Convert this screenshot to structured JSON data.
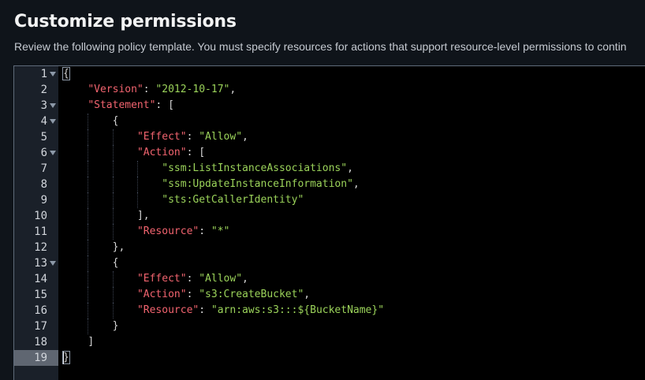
{
  "header": {
    "title": "Customize permissions",
    "description": "Review the following policy template. You must specify resources for actions that support resource-level permissions to contin"
  },
  "editor": {
    "active_line": 19,
    "lines": [
      {
        "n": "1",
        "fold": true,
        "indent": 0,
        "tokens": [
          {
            "t": "bracket",
            "v": "{",
            "boxed": true
          }
        ]
      },
      {
        "n": "2",
        "fold": false,
        "indent": 1,
        "tokens": [
          {
            "t": "key",
            "v": "\"Version\""
          },
          {
            "t": "punc",
            "v": ": "
          },
          {
            "t": "str",
            "v": "\"2012-10-17\""
          },
          {
            "t": "punc",
            "v": ","
          }
        ]
      },
      {
        "n": "3",
        "fold": true,
        "indent": 1,
        "tokens": [
          {
            "t": "key",
            "v": "\"Statement\""
          },
          {
            "t": "punc",
            "v": ": "
          },
          {
            "t": "bracket",
            "v": "["
          }
        ]
      },
      {
        "n": "4",
        "fold": true,
        "indent": 2,
        "tokens": [
          {
            "t": "bracket",
            "v": "{"
          }
        ]
      },
      {
        "n": "5",
        "fold": false,
        "indent": 3,
        "tokens": [
          {
            "t": "key",
            "v": "\"Effect\""
          },
          {
            "t": "punc",
            "v": ": "
          },
          {
            "t": "str",
            "v": "\"Allow\""
          },
          {
            "t": "punc",
            "v": ","
          }
        ]
      },
      {
        "n": "6",
        "fold": true,
        "indent": 3,
        "tokens": [
          {
            "t": "key",
            "v": "\"Action\""
          },
          {
            "t": "punc",
            "v": ": "
          },
          {
            "t": "bracket",
            "v": "["
          }
        ]
      },
      {
        "n": "7",
        "fold": false,
        "indent": 4,
        "tokens": [
          {
            "t": "str",
            "v": "\"ssm:ListInstanceAssociations\""
          },
          {
            "t": "punc",
            "v": ","
          }
        ]
      },
      {
        "n": "8",
        "fold": false,
        "indent": 4,
        "tokens": [
          {
            "t": "str",
            "v": "\"ssm:UpdateInstanceInformation\""
          },
          {
            "t": "punc",
            "v": ","
          }
        ]
      },
      {
        "n": "9",
        "fold": false,
        "indent": 4,
        "tokens": [
          {
            "t": "str",
            "v": "\"sts:GetCallerIdentity\""
          }
        ]
      },
      {
        "n": "10",
        "fold": false,
        "indent": 3,
        "tokens": [
          {
            "t": "bracket",
            "v": "]"
          },
          {
            "t": "punc",
            "v": ","
          }
        ]
      },
      {
        "n": "11",
        "fold": false,
        "indent": 3,
        "tokens": [
          {
            "t": "key",
            "v": "\"Resource\""
          },
          {
            "t": "punc",
            "v": ": "
          },
          {
            "t": "str",
            "v": "\"*\""
          }
        ]
      },
      {
        "n": "12",
        "fold": false,
        "indent": 2,
        "tokens": [
          {
            "t": "bracket",
            "v": "}"
          },
          {
            "t": "punc",
            "v": ","
          }
        ]
      },
      {
        "n": "13",
        "fold": true,
        "indent": 2,
        "tokens": [
          {
            "t": "bracket",
            "v": "{"
          }
        ]
      },
      {
        "n": "14",
        "fold": false,
        "indent": 3,
        "tokens": [
          {
            "t": "key",
            "v": "\"Effect\""
          },
          {
            "t": "punc",
            "v": ": "
          },
          {
            "t": "str",
            "v": "\"Allow\""
          },
          {
            "t": "punc",
            "v": ","
          }
        ]
      },
      {
        "n": "15",
        "fold": false,
        "indent": 3,
        "tokens": [
          {
            "t": "key",
            "v": "\"Action\""
          },
          {
            "t": "punc",
            "v": ": "
          },
          {
            "t": "str",
            "v": "\"s3:CreateBucket\""
          },
          {
            "t": "punc",
            "v": ","
          }
        ]
      },
      {
        "n": "16",
        "fold": false,
        "indent": 3,
        "tokens": [
          {
            "t": "key",
            "v": "\"Resource\""
          },
          {
            "t": "punc",
            "v": ": "
          },
          {
            "t": "str",
            "v": "\"arn:aws:s3:::${BucketName}\""
          }
        ]
      },
      {
        "n": "17",
        "fold": false,
        "indent": 2,
        "tokens": [
          {
            "t": "bracket",
            "v": "}"
          }
        ]
      },
      {
        "n": "18",
        "fold": false,
        "indent": 1,
        "tokens": [
          {
            "t": "bracket",
            "v": "]"
          }
        ]
      },
      {
        "n": "19",
        "fold": false,
        "indent": 0,
        "tokens": [
          {
            "t": "bracket",
            "v": "}",
            "boxed": true
          }
        ]
      }
    ]
  },
  "colors": {
    "key": "#f2646f",
    "string": "#9bd35a",
    "punctuation": "#d4d4d4",
    "editor_background": "#000000",
    "gutter_background": "#1a2029",
    "active_gutter": "#5f6671"
  },
  "icons": {
    "fold": "chevron-down-icon"
  }
}
